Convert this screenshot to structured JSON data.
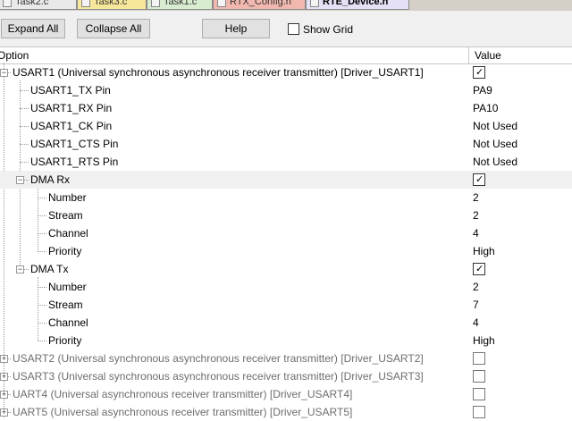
{
  "tabs": [
    {
      "label": "Task2.c",
      "color": "#e9e9e9",
      "active": false
    },
    {
      "label": "Task3.c",
      "color": "#f7e79a",
      "active": false
    },
    {
      "label": "Task1.c",
      "color": "#d8ecd0",
      "active": false
    },
    {
      "label": "RTX_Config.h",
      "color": "#f2b8b0",
      "active": false
    },
    {
      "label": "RTE_Device.h",
      "color": "#e6e0f5",
      "active": true
    }
  ],
  "toolbar": {
    "expand_all": "Expand All",
    "collapse_all": "Collapse All",
    "help": "Help",
    "show_grid": "Show Grid"
  },
  "grid": {
    "col_option": "Option",
    "col_value": "Value",
    "rows": [
      {
        "label": "USART1 (Universal synchronous asynchronous receiver transmitter) [Driver_USART1]",
        "value": "",
        "checkbox": true,
        "checked": true,
        "expander": "-",
        "level": 0,
        "grey": false
      },
      {
        "label": "USART1_TX Pin",
        "value": "PA9",
        "level": 1
      },
      {
        "label": "USART1_RX Pin",
        "value": "PA10",
        "level": 1
      },
      {
        "label": "USART1_CK Pin",
        "value": "Not Used",
        "level": 1
      },
      {
        "label": "USART1_CTS Pin",
        "value": "Not Used",
        "level": 1
      },
      {
        "label": "USART1_RTS Pin",
        "value": "Not Used",
        "level": 1
      },
      {
        "label": "DMA Rx",
        "value": "",
        "checkbox": true,
        "checked": true,
        "expander": "-",
        "level": 1,
        "selected": true
      },
      {
        "label": "Number",
        "value": "2",
        "level": 2
      },
      {
        "label": "Stream",
        "value": "2",
        "level": 2
      },
      {
        "label": "Channel",
        "value": "4",
        "level": 2
      },
      {
        "label": "Priority",
        "value": "High",
        "level": 2
      },
      {
        "label": "DMA Tx",
        "value": "",
        "checkbox": true,
        "checked": true,
        "expander": "-",
        "level": 1
      },
      {
        "label": "Number",
        "value": "2",
        "level": 2
      },
      {
        "label": "Stream",
        "value": "7",
        "level": 2
      },
      {
        "label": "Channel",
        "value": "4",
        "level": 2
      },
      {
        "label": "Priority",
        "value": "High",
        "level": 2
      },
      {
        "label": "USART2 (Universal synchronous asynchronous receiver transmitter) [Driver_USART2]",
        "value": "",
        "checkbox": true,
        "checked": false,
        "expander": "+",
        "level": 0,
        "grey": true
      },
      {
        "label": "USART3 (Universal synchronous asynchronous receiver transmitter) [Driver_USART3]",
        "value": "",
        "checkbox": true,
        "checked": false,
        "expander": "+",
        "level": 0,
        "grey": true
      },
      {
        "label": "UART4 (Universal asynchronous receiver transmitter) [Driver_USART4]",
        "value": "",
        "checkbox": true,
        "checked": false,
        "expander": "+",
        "level": 0,
        "grey": true
      },
      {
        "label": "UART5 (Universal asynchronous receiver transmitter) [Driver_USART5]",
        "value": "",
        "checkbox": true,
        "checked": false,
        "expander": "+",
        "level": 0,
        "grey": true
      }
    ]
  }
}
